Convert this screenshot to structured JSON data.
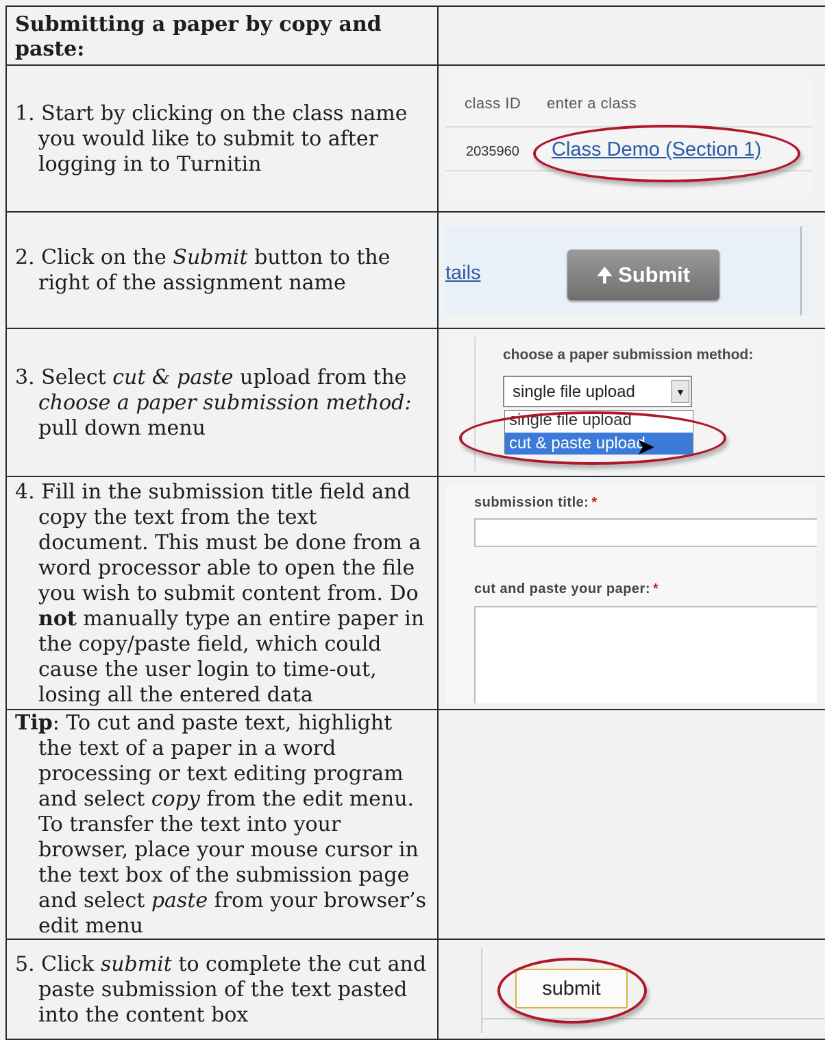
{
  "heading": "Submitting a paper by copy and paste:",
  "steps": {
    "s1": "1. Start by clicking on the class name you would like to submit to after logging in to Turnitin",
    "s2_a": "2. Click on the ",
    "s2_em": "Submit",
    "s2_b": " button to the right of the assignment name",
    "s3_a": "3. Select ",
    "s3_em1": "cut & paste",
    "s3_b": " upload from the ",
    "s3_em2": "choose a paper submission method:",
    "s3_c": " pull down menu",
    "s4_a": "4. Fill in the submission title field and copy the text from the text document. This must be done from a word processor able to open the file you wish to submit content from. Do ",
    "s4_bold": "not",
    "s4_b": " manually type an entire paper in the copy/paste field, which could cause the user login to time-out, losing all the entered data",
    "tip_label": "Tip",
    "tip_a": ": To cut and paste text, highlight the text of a paper in a word processing or text editing program and select ",
    "tip_em1": "copy",
    "tip_b": " from the edit menu. To transfer the text into your browser, place your mouse cursor in the text box of the submission page and select ",
    "tip_em2": "paste",
    "tip_c": " from your browser’s edit menu",
    "s5_a": "5. Click ",
    "s5_em": "submit",
    "s5_b": " to complete the cut and paste submission of the text pasted into the content box"
  },
  "shot1": {
    "col_class_id": "class ID",
    "col_enter": "enter a class",
    "class_id": "2035960",
    "class_name": "Class Demo (Section 1)"
  },
  "shot2": {
    "partial_link": "tails",
    "submit_label": "Submit",
    "arrow_icon": "up-arrow-icon"
  },
  "shot3": {
    "label": "choose a paper submission method:",
    "selected": "single file upload",
    "options": [
      "single file upload",
      "cut & paste upload"
    ],
    "highlighted": "cut & paste upload"
  },
  "shot4": {
    "title_label": "submission title:",
    "paste_label": "cut and paste your paper:",
    "required_mark": "*"
  },
  "shot6": {
    "submit_label": "submit"
  },
  "colors": {
    "oval": "#b1172a",
    "link": "#2a5aa6",
    "highlight": "#3b7ad8"
  }
}
